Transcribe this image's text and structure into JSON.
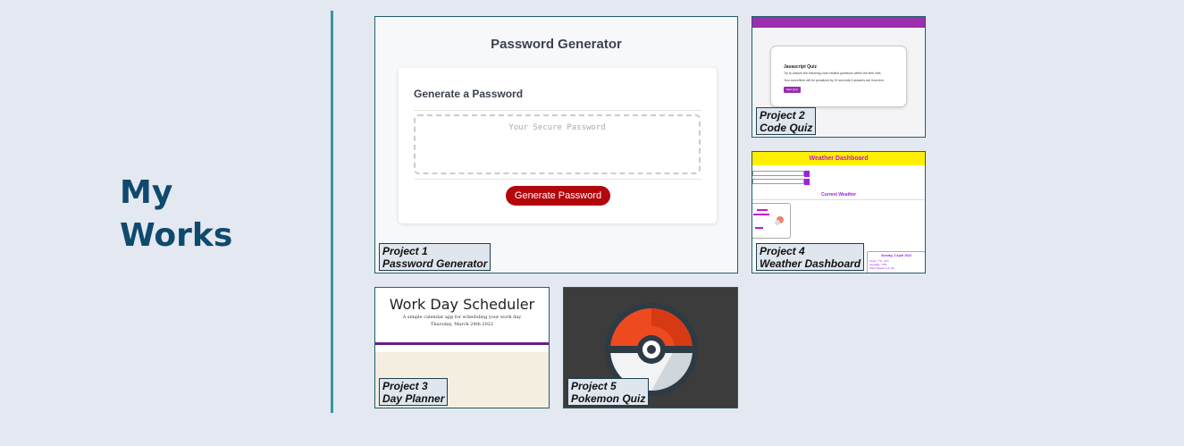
{
  "section": {
    "title": "My Works"
  },
  "colors": {
    "background": "#e4e8f0",
    "title": "#0e4a6e",
    "divider": "#3a94a4",
    "card_border": "#1f5f6b"
  },
  "projects": [
    {
      "number": "Project 1",
      "name": "Password Generator",
      "preview": {
        "title": "Password Generator",
        "subtitle": "Generate a Password",
        "placeholder": "Your Secure Password",
        "button": "Generate Password"
      }
    },
    {
      "number": "Project 2",
      "name": "Code Quiz",
      "preview": {
        "title": "Javascript Quiz",
        "line1": "Try to answer the following code-related questions within the time limit.",
        "line2": "Your score/time will be penalized by 10 seconds if answers are incorrect.",
        "button": "Start Quiz"
      }
    },
    {
      "number": "Project 3",
      "name": "Day Planner",
      "preview": {
        "title": "Work Day Scheduler",
        "subtitle": "A simple calendar app for scheduling your work day",
        "date": "Thursday, March 24th 2022"
      }
    },
    {
      "number": "Project 4",
      "name": "Weather Dashboard",
      "preview": {
        "title": "Weather Dashboard",
        "current": "Current Weather",
        "forecast_date": "Sunday, 3 April 2022",
        "forecast_temp": "Temp: 7°C - 9°C",
        "forecast_humidity": "Humidity: 77%",
        "forecast_wind": "Wind Speed: 5.4 m/s"
      }
    },
    {
      "number": "Project 5",
      "name": "Pokemon Quiz",
      "preview": {
        "icon": "pokeball-icon"
      }
    }
  ]
}
